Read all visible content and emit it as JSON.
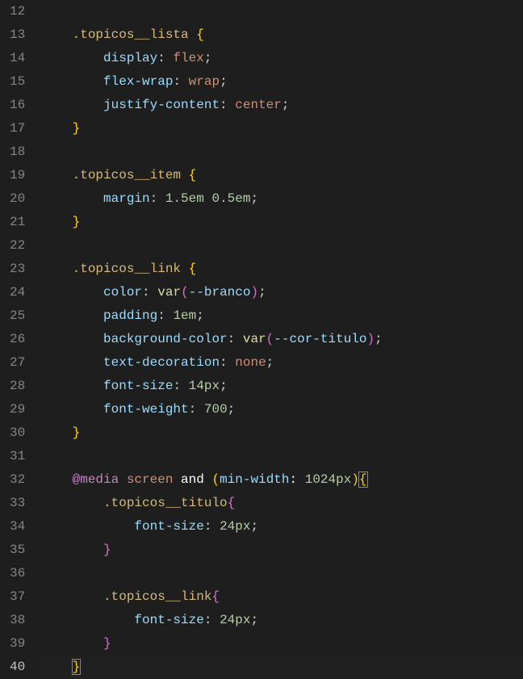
{
  "startLine": 12,
  "activeLine": 40,
  "lines": [
    {
      "n": 12,
      "html": ""
    },
    {
      "n": 13,
      "indent": 1,
      "html": "    <span class='tk-selector'>.topicos__lista</span> <span class='tk-brace-y'>{</span>"
    },
    {
      "n": 14,
      "indent": 2,
      "html": "        <span class='tk-prop'>display</span><span class='tk-punct'>:</span> <span class='tk-val'>flex</span><span class='tk-punct'>;</span>"
    },
    {
      "n": 15,
      "indent": 2,
      "html": "        <span class='tk-prop'>flex-wrap</span><span class='tk-punct'>:</span> <span class='tk-val'>wrap</span><span class='tk-punct'>;</span>"
    },
    {
      "n": 16,
      "indent": 2,
      "html": "        <span class='tk-prop'>justify-content</span><span class='tk-punct'>:</span> <span class='tk-val'>center</span><span class='tk-punct'>;</span>"
    },
    {
      "n": 17,
      "indent": 1,
      "html": "    <span class='tk-brace-y'>}</span>"
    },
    {
      "n": 18,
      "html": ""
    },
    {
      "n": 19,
      "indent": 1,
      "html": "    <span class='tk-selector'>.topicos__item</span> <span class='tk-brace-y'>{</span>"
    },
    {
      "n": 20,
      "indent": 2,
      "html": "        <span class='tk-prop'>margin</span><span class='tk-punct'>:</span> <span class='tk-num'>1.5em</span> <span class='tk-num'>0.5em</span><span class='tk-punct'>;</span>"
    },
    {
      "n": 21,
      "indent": 1,
      "html": "    <span class='tk-brace-y'>}</span>"
    },
    {
      "n": 22,
      "html": ""
    },
    {
      "n": 23,
      "indent": 1,
      "html": "    <span class='tk-selector'>.topicos__link</span> <span class='tk-brace-y'>{</span>"
    },
    {
      "n": 24,
      "indent": 2,
      "html": "        <span class='tk-prop'>color</span><span class='tk-punct'>:</span> <span class='tk-func'>var</span><span class='tk-brace-p'>(</span><span class='tk-prop'>--branco</span><span class='tk-brace-p'>)</span><span class='tk-punct'>;</span>"
    },
    {
      "n": 25,
      "indent": 2,
      "html": "        <span class='tk-prop'>padding</span><span class='tk-punct'>:</span> <span class='tk-num'>1em</span><span class='tk-punct'>;</span>"
    },
    {
      "n": 26,
      "indent": 2,
      "html": "        <span class='tk-prop'>background-color</span><span class='tk-punct'>:</span> <span class='tk-func'>var</span><span class='tk-brace-p'>(</span><span class='tk-prop'>--cor-titulo</span><span class='tk-brace-p'>)</span><span class='tk-punct'>;</span>"
    },
    {
      "n": 27,
      "indent": 2,
      "html": "        <span class='tk-prop'>text-decoration</span><span class='tk-punct'>:</span> <span class='tk-val'>none</span><span class='tk-punct'>;</span>"
    },
    {
      "n": 28,
      "indent": 2,
      "html": "        <span class='tk-prop'>font-size</span><span class='tk-punct'>:</span> <span class='tk-num'>14px</span><span class='tk-punct'>;</span>"
    },
    {
      "n": 29,
      "indent": 2,
      "html": "        <span class='tk-prop'>font-weight</span><span class='tk-punct'>:</span> <span class='tk-num'>700</span><span class='tk-punct'>;</span>"
    },
    {
      "n": 30,
      "indent": 1,
      "html": "    <span class='tk-brace-y'>}</span>"
    },
    {
      "n": 31,
      "html": ""
    },
    {
      "n": 32,
      "indent": 1,
      "html": "    <span class='tk-kw'>@media</span> <span class='tk-val'>screen</span> <span class='tk-white'>and</span> <span class='tk-brace-y'>(</span><span class='tk-prop'>min-width</span><span class='tk-white'>:</span> <span class='tk-num'>1024px</span><span class='tk-brace-y'>)</span><span class='tk-brace-y bracket-highlight'>{</span>"
    },
    {
      "n": 33,
      "indent": 2,
      "html": "        <span class='tk-selector'>.topicos__titulo</span><span class='tk-brace-p'>{</span>"
    },
    {
      "n": 34,
      "indent": 3,
      "html": "            <span class='tk-prop'>font-size</span><span class='tk-punct'>:</span> <span class='tk-num'>24px</span><span class='tk-punct'>;</span>"
    },
    {
      "n": 35,
      "indent": 2,
      "html": "        <span class='tk-brace-p'>}</span>"
    },
    {
      "n": 36,
      "html": ""
    },
    {
      "n": 37,
      "indent": 2,
      "html": "        <span class='tk-selector'>.topicos__link</span><span class='tk-brace-p'>{</span>"
    },
    {
      "n": 38,
      "indent": 3,
      "html": "            <span class='tk-prop'>font-size</span><span class='tk-punct'>:</span> <span class='tk-num'>24px</span><span class='tk-punct'>;</span>"
    },
    {
      "n": 39,
      "indent": 2,
      "html": "        <span class='tk-brace-p'>}</span>"
    },
    {
      "n": 40,
      "indent": 1,
      "active": true,
      "html": "    <span class='tk-brace-y bracket-highlight'>}</span>"
    }
  ]
}
